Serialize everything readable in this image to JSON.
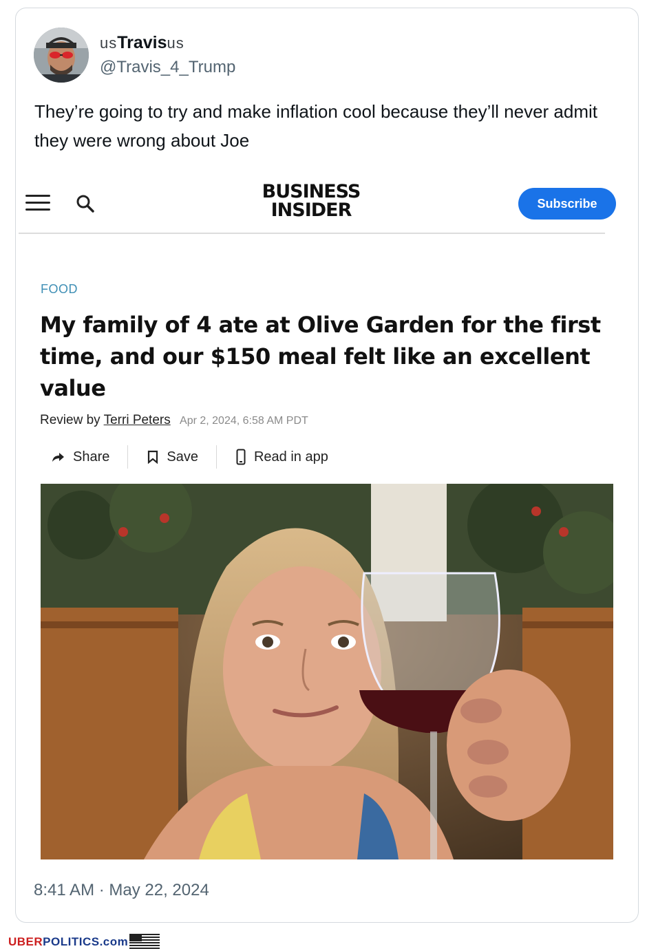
{
  "tweet": {
    "name_prefix": "us",
    "name_main": "Travis",
    "name_suffix": "us",
    "handle": "@Travis_4_Trump",
    "text": "They’re going to try and make inflation cool because they’ll never admit they were wrong about Joe",
    "timestamp": "8:41 AM · May 22, 2024"
  },
  "embedded_article": {
    "logo_line1": "BUSINESS",
    "logo_line2": "INSIDER",
    "subscribe_label": "Subscribe",
    "section": "FOOD",
    "headline": "My family of 4 ate at Olive Garden for the first time, and our $150 meal felt like an excellent value",
    "byline_prefix": "Review by",
    "author": "Terri Peters",
    "date": "Apr 2, 2024, 6:58 AM PDT",
    "actions": {
      "share": "Share",
      "save": "Save",
      "read_in_app": "Read in app"
    }
  },
  "watermark": {
    "uber": "UBER",
    "politics": "POLITICS.com"
  },
  "colors": {
    "subscribe_blue": "#1a73e8",
    "section_teal": "#3f8fb5",
    "meta_gray": "#536471"
  },
  "icons": [
    "hamburger-menu-icon",
    "search-icon",
    "share-arrow-icon",
    "bookmark-icon",
    "phone-icon",
    "us-flag-icon"
  ]
}
